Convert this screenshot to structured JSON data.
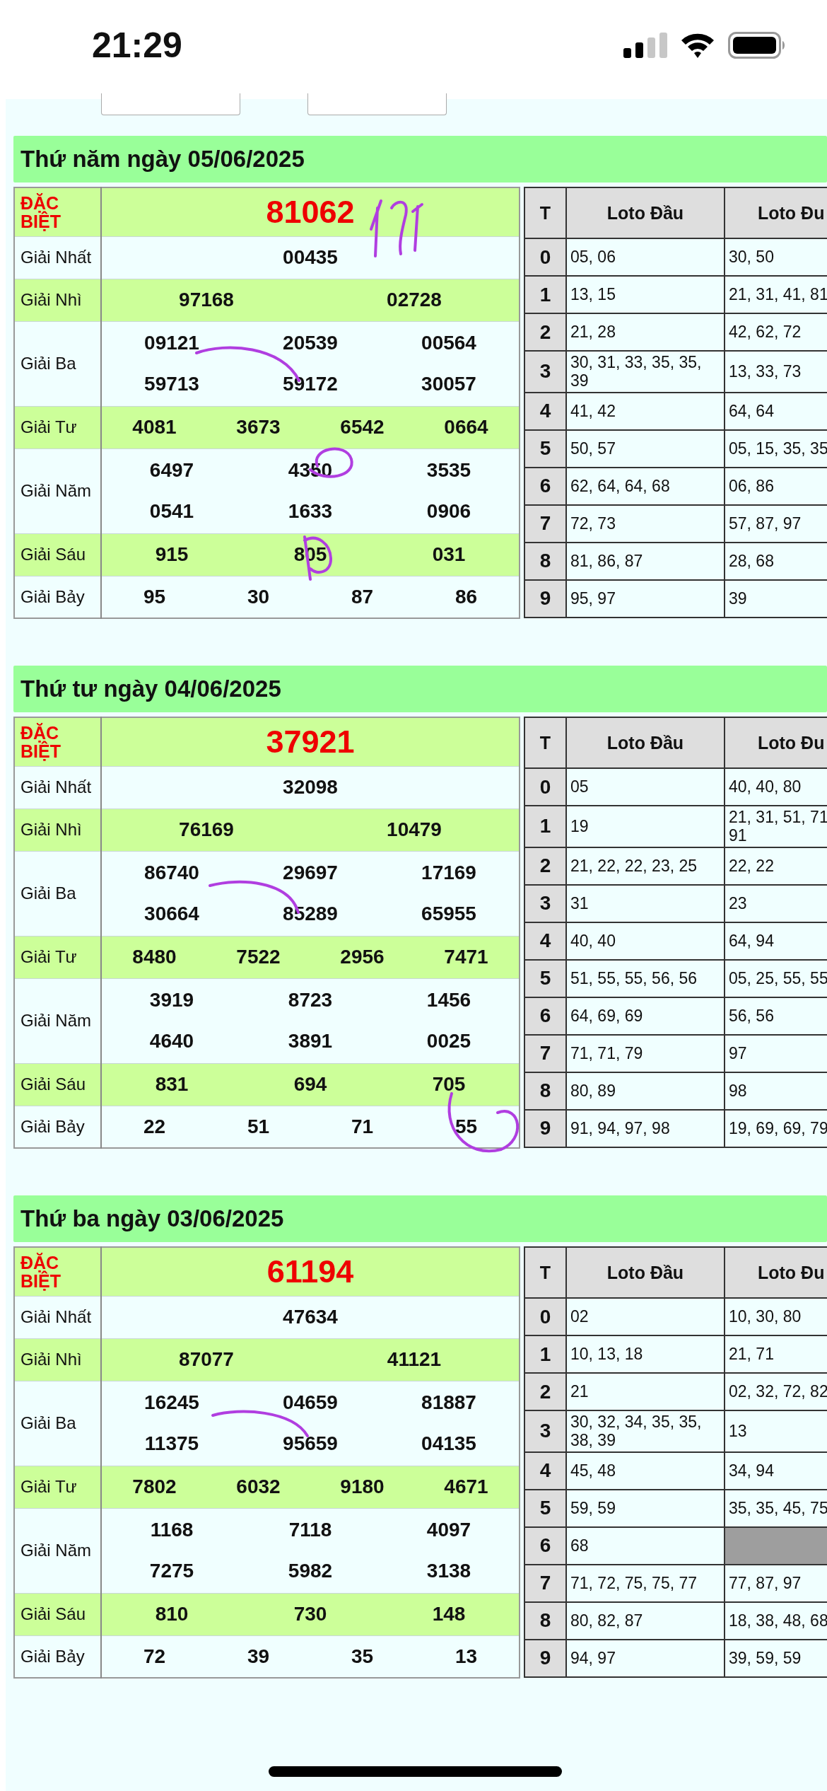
{
  "status_bar": {
    "time": "21:29"
  },
  "days": [
    {
      "title": "Thứ năm ngày 05/06/2025",
      "prizes": [
        {
          "kind": "special",
          "label": "ĐẶC BIỆT",
          "numbers": [
            "81062"
          ]
        },
        {
          "kind": "normal",
          "label": "Giải Nhất",
          "numbers": [
            "00435"
          ]
        },
        {
          "kind": "normal",
          "label": "Giải Nhì",
          "numbers": [
            "97168",
            "02728"
          ]
        },
        {
          "kind": "normal",
          "label": "Giải Ba",
          "numbers": [
            "09121",
            "20539",
            "00564",
            "59713",
            "59172",
            "30057"
          ]
        },
        {
          "kind": "normal",
          "label": "Giải Tư",
          "numbers": [
            "4081",
            "3673",
            "6542",
            "0664"
          ]
        },
        {
          "kind": "normal",
          "label": "Giải Năm",
          "numbers": [
            "6497",
            "4350",
            "3535",
            "0541",
            "1633",
            "0906"
          ]
        },
        {
          "kind": "normal",
          "label": "Giải Sáu",
          "numbers": [
            "915",
            "805",
            "031"
          ]
        },
        {
          "kind": "normal",
          "label": "Giải Bảy",
          "numbers": [
            "95",
            "30",
            "87",
            "86"
          ]
        }
      ],
      "loto": {
        "columns": [
          "T",
          "Loto Đầu",
          "Loto Đu"
        ],
        "rows": [
          {
            "digit": "0",
            "head": "05, 06",
            "tail": "30, 50"
          },
          {
            "digit": "1",
            "head": "13, 15",
            "tail": "21, 31, 41, 81"
          },
          {
            "digit": "2",
            "head": "21, 28",
            "tail": "42, 62, 72"
          },
          {
            "digit": "3",
            "head": "30, 31, 33, 35, 35, 39",
            "tail": "13, 33, 73"
          },
          {
            "digit": "4",
            "head": "41, 42",
            "tail": "64, 64"
          },
          {
            "digit": "5",
            "head": "50, 57",
            "tail": "05, 15, 35, 35"
          },
          {
            "digit": "6",
            "head": "62, 64, 64, 68",
            "tail": "06, 86"
          },
          {
            "digit": "7",
            "head": "72, 73",
            "tail": "57, 87, 97"
          },
          {
            "digit": "8",
            "head": "81, 86, 87",
            "tail": "28, 68"
          },
          {
            "digit": "9",
            "head": "95, 97",
            "tail": "39"
          }
        ]
      }
    },
    {
      "title": "Thứ tư ngày 04/06/2025",
      "prizes": [
        {
          "kind": "special",
          "label": "ĐẶC BIỆT",
          "numbers": [
            "37921"
          ]
        },
        {
          "kind": "normal",
          "label": "Giải Nhất",
          "numbers": [
            "32098"
          ]
        },
        {
          "kind": "normal",
          "label": "Giải Nhì",
          "numbers": [
            "76169",
            "10479"
          ]
        },
        {
          "kind": "normal",
          "label": "Giải Ba",
          "numbers": [
            "86740",
            "29697",
            "17169",
            "30664",
            "85289",
            "65955"
          ]
        },
        {
          "kind": "normal",
          "label": "Giải Tư",
          "numbers": [
            "8480",
            "7522",
            "2956",
            "7471"
          ]
        },
        {
          "kind": "normal",
          "label": "Giải Năm",
          "numbers": [
            "3919",
            "8723",
            "1456",
            "4640",
            "3891",
            "0025"
          ]
        },
        {
          "kind": "normal",
          "label": "Giải Sáu",
          "numbers": [
            "831",
            "694",
            "705"
          ]
        },
        {
          "kind": "normal",
          "label": "Giải Bảy",
          "numbers": [
            "22",
            "51",
            "71",
            "55"
          ]
        }
      ],
      "loto": {
        "columns": [
          "T",
          "Loto Đầu",
          "Loto Đu"
        ],
        "rows": [
          {
            "digit": "0",
            "head": "05",
            "tail": "40, 40, 80"
          },
          {
            "digit": "1",
            "head": "19",
            "tail": "21, 31, 51, 71\n91"
          },
          {
            "digit": "2",
            "head": "21, 22, 22, 23, 25",
            "tail": "22, 22"
          },
          {
            "digit": "3",
            "head": "31",
            "tail": "23"
          },
          {
            "digit": "4",
            "head": "40, 40",
            "tail": "64, 94"
          },
          {
            "digit": "5",
            "head": "51, 55, 55, 56, 56",
            "tail": "05, 25, 55, 55"
          },
          {
            "digit": "6",
            "head": "64, 69, 69",
            "tail": "56, 56"
          },
          {
            "digit": "7",
            "head": "71, 71, 79",
            "tail": "97"
          },
          {
            "digit": "8",
            "head": "80, 89",
            "tail": "98"
          },
          {
            "digit": "9",
            "head": "91, 94, 97, 98",
            "tail": "19, 69, 69, 79"
          }
        ]
      }
    },
    {
      "title": "Thứ ba ngày 03/06/2025",
      "prizes": [
        {
          "kind": "special",
          "label": "ĐẶC BIỆT",
          "numbers": [
            "61194"
          ]
        },
        {
          "kind": "normal",
          "label": "Giải Nhất",
          "numbers": [
            "47634"
          ]
        },
        {
          "kind": "normal",
          "label": "Giải Nhì",
          "numbers": [
            "87077",
            "41121"
          ]
        },
        {
          "kind": "normal",
          "label": "Giải Ba",
          "numbers": [
            "16245",
            "04659",
            "81887",
            "11375",
            "95659",
            "04135"
          ]
        },
        {
          "kind": "normal",
          "label": "Giải Tư",
          "numbers": [
            "7802",
            "6032",
            "9180",
            "4671"
          ]
        },
        {
          "kind": "normal",
          "label": "Giải Năm",
          "numbers": [
            "1168",
            "7118",
            "4097",
            "7275",
            "5982",
            "3138"
          ]
        },
        {
          "kind": "normal",
          "label": "Giải Sáu",
          "numbers": [
            "810",
            "730",
            "148"
          ]
        },
        {
          "kind": "normal",
          "label": "Giải Bảy",
          "numbers": [
            "72",
            "39",
            "35",
            "13"
          ]
        }
      ],
      "loto": {
        "columns": [
          "T",
          "Loto Đầu",
          "Loto Đu"
        ],
        "rows": [
          {
            "digit": "0",
            "head": "02",
            "tail": "10, 30, 80"
          },
          {
            "digit": "1",
            "head": "10, 13, 18",
            "tail": "21, 71"
          },
          {
            "digit": "2",
            "head": "21",
            "tail": "02, 32, 72, 82"
          },
          {
            "digit": "3",
            "head": "30, 32, 34, 35, 35, 38, 39",
            "tail": "13"
          },
          {
            "digit": "4",
            "head": "45, 48",
            "tail": "34, 94"
          },
          {
            "digit": "5",
            "head": "59, 59",
            "tail": "35, 35, 45, 75"
          },
          {
            "digit": "6",
            "head": "68"
          },
          {
            "digit": "7",
            "head": "71, 72, 75, 75, 77",
            "tail": "77, 87, 97"
          },
          {
            "digit": "8",
            "head": "80, 82, 87",
            "tail": "18, 38, 48, 68"
          },
          {
            "digit": "9",
            "head": "94, 97",
            "tail": "39, 59, 59"
          }
        ]
      }
    }
  ]
}
